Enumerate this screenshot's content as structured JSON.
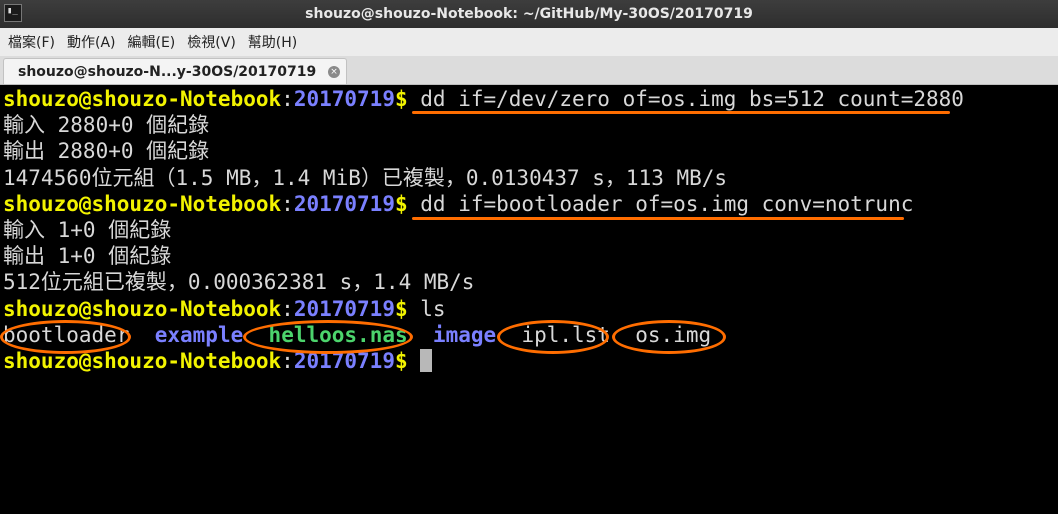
{
  "window": {
    "title": "shouzo@shouzo-Notebook: ~/GitHub/My-30OS/20170719",
    "icon": "terminal-icon",
    "icon_glyph": "▮_"
  },
  "menu": [
    "檔案(F)",
    "動作(A)",
    "編輯(E)",
    "檢視(V)",
    "幫助(H)"
  ],
  "tab": {
    "label": "shouzo@shouzo-N...y-30OS/20170719",
    "close_glyph": "×"
  },
  "prompt": {
    "user": "shouzo@shouzo-Notebook",
    "colon": ":",
    "path": "20170719",
    "dollar": "$"
  },
  "lines": [
    {
      "type": "prompt",
      "cmd": "dd if=/dev/zero of=os.img bs=512 count=2880"
    },
    {
      "type": "out",
      "text": "輸入 2880+0 個紀錄"
    },
    {
      "type": "out",
      "text": "輸出 2880+0 個紀錄"
    },
    {
      "type": "out",
      "text": "1474560位元組（1.5 MB，1.4 MiB）已複製，0.0130437 s，113 MB/s"
    },
    {
      "type": "prompt",
      "cmd": "dd if=bootloader of=os.img conv=notrunc"
    },
    {
      "type": "out",
      "text": "輸入 1+0 個紀錄"
    },
    {
      "type": "out",
      "text": "輸出 1+0 個紀錄"
    },
    {
      "type": "out",
      "text": "512位元組已複製，0.000362381 s，1.4 MB/s"
    },
    {
      "type": "prompt",
      "cmd": "ls"
    },
    {
      "type": "ls",
      "items": [
        {
          "name": "bootloader",
          "kind": "file"
        },
        {
          "name": "example",
          "kind": "dir"
        },
        {
          "name": "helloos.nas",
          "kind": "exec"
        },
        {
          "name": "image",
          "kind": "dir"
        },
        {
          "name": "ipl.lst",
          "kind": "file"
        },
        {
          "name": "os.img",
          "kind": "file"
        }
      ]
    },
    {
      "type": "prompt",
      "cmd": "",
      "cursor": true
    }
  ],
  "highlight_color": "#ff6d00"
}
